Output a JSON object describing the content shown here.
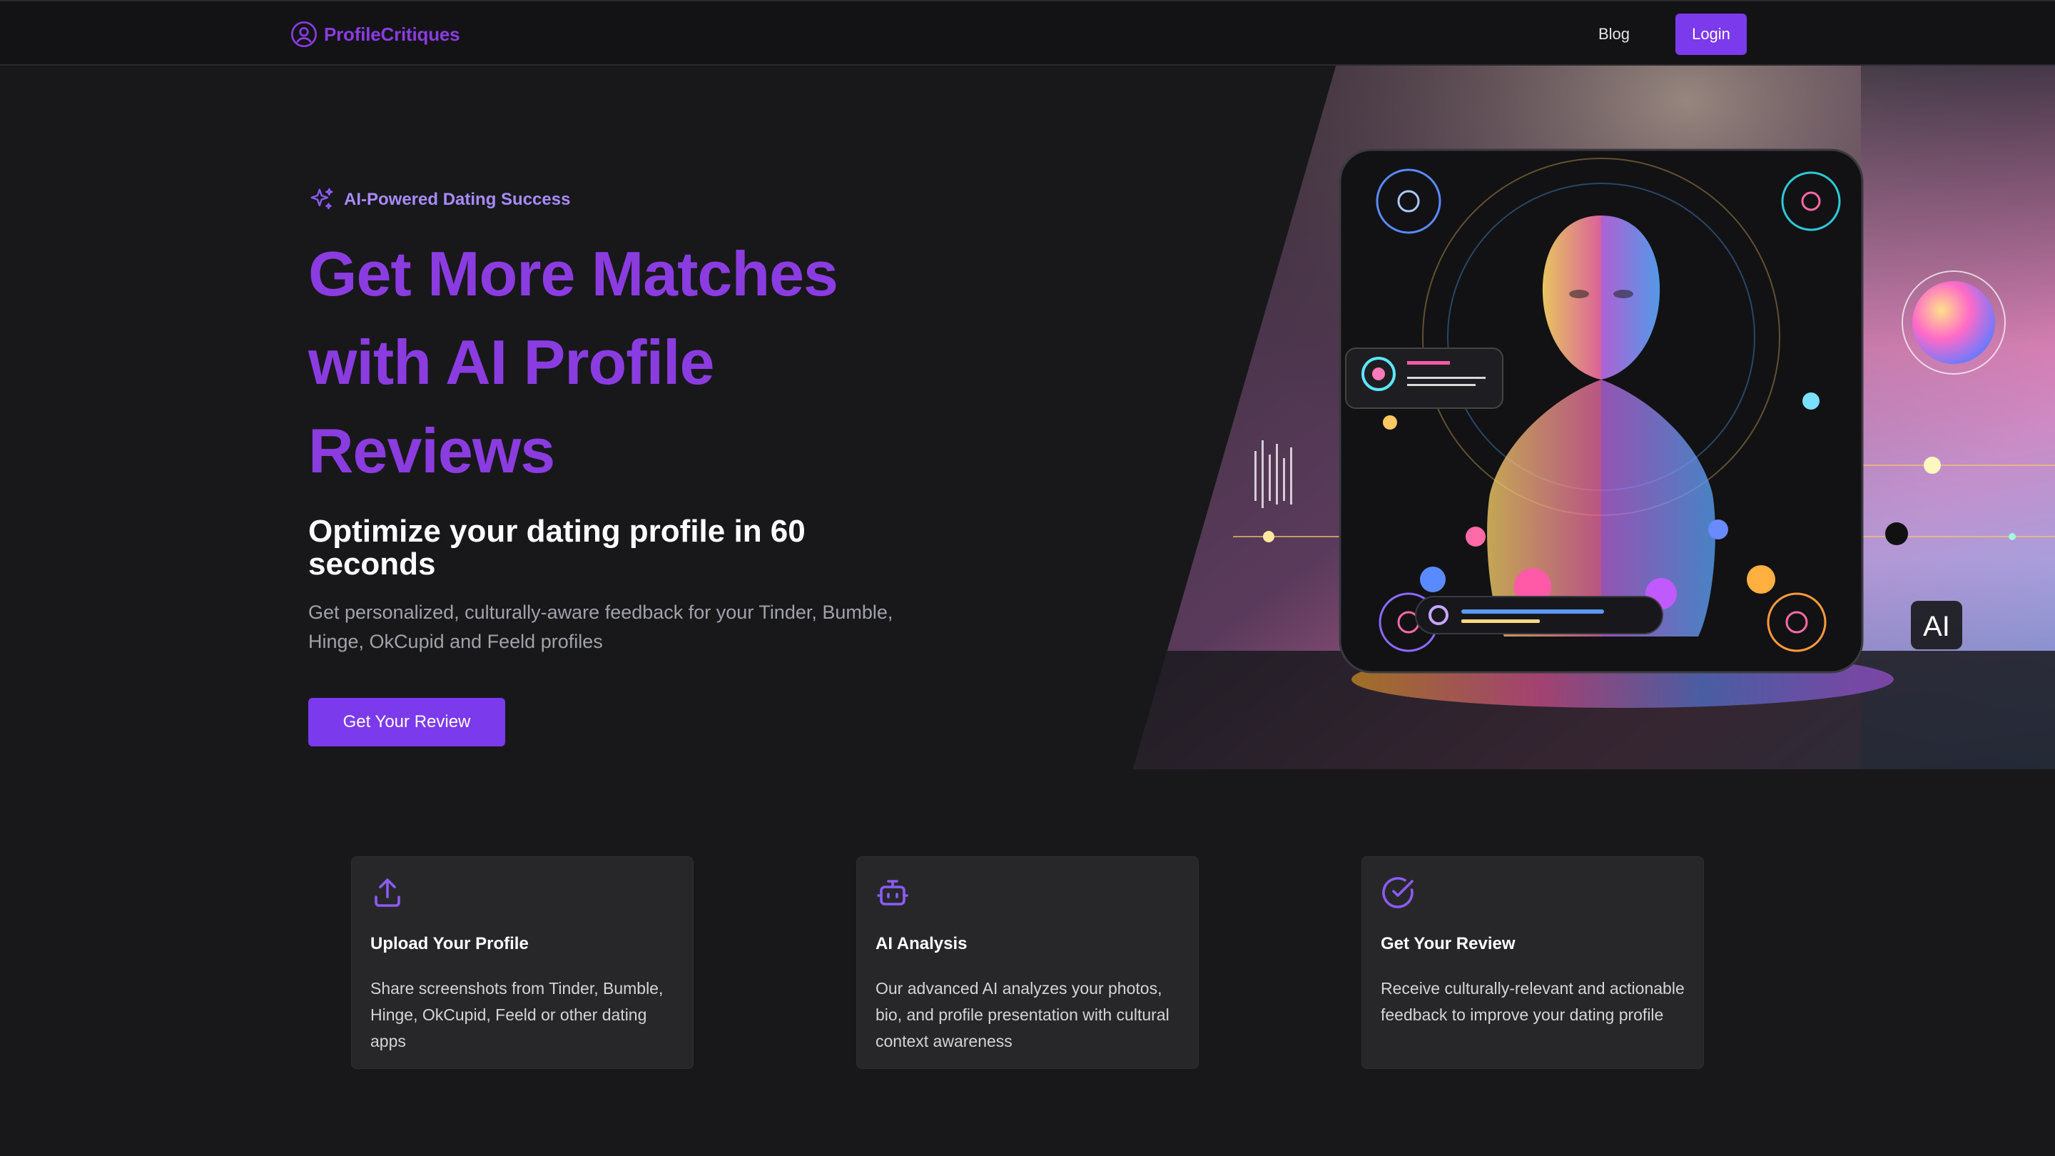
{
  "colors": {
    "accent": "#7c3aed",
    "brand": "#8b3ce0",
    "background": "#18181b",
    "card": "#27272a",
    "badge_text": "#a78bfa"
  },
  "nav": {
    "brand_name": "ProfileCritiques",
    "brand_icon": "user-circle-icon",
    "blog_label": "Blog",
    "login_label": "Login"
  },
  "hero": {
    "badge_icon": "sparkles-icon",
    "badge_text": "AI-Powered Dating Success",
    "title": "Get More Matches with AI Profile Reviews",
    "subtitle": "Optimize your dating profile in 60 seconds",
    "description": "Get personalized, culturally-aware feedback for your Tinder, Bumble, Hinge, OkCupid and Feeld profiles",
    "cta_label": "Get Your Review",
    "art_badge": "AI"
  },
  "features": [
    {
      "icon": "upload-icon",
      "title": "Upload Your Profile",
      "body": "Share screenshots from Tinder, Bumble, Hinge, OkCupid, Feeld or other dating apps"
    },
    {
      "icon": "bot-icon",
      "title": "AI Analysis",
      "body": "Our advanced AI analyzes your photos, bio, and profile presentation with cultural context awareness"
    },
    {
      "icon": "check-circle-icon",
      "title": "Get Your Review",
      "body": "Receive culturally-relevant and actionable feedback to improve your dating profile"
    }
  ]
}
